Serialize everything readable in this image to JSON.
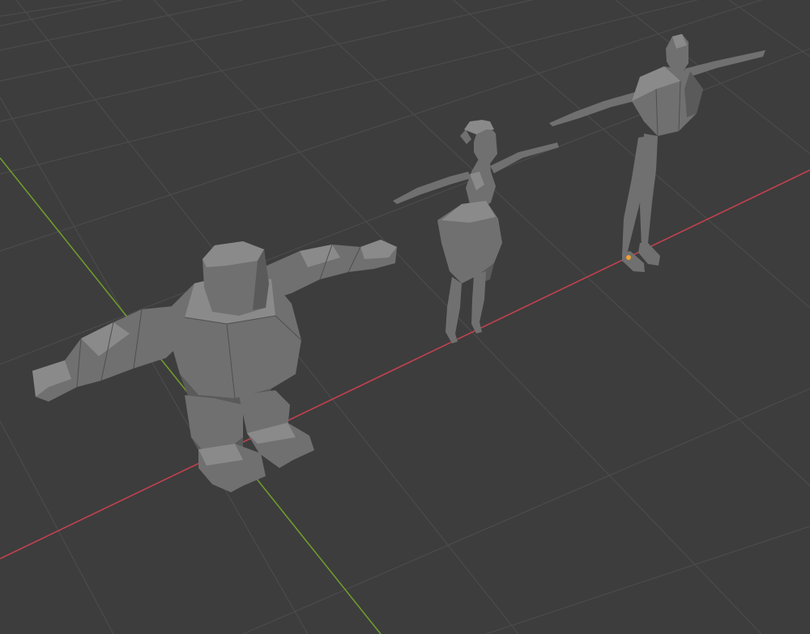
{
  "viewport": {
    "background_color": "#3d3d3d",
    "grid_color": "#4b4b4b",
    "x_axis_color": "#c2414f",
    "y_axis_color": "#6f9a2d",
    "origin_marker_color": "#f0a030"
  },
  "objects": [
    {
      "name": "chunky-character",
      "color": "#7a7a7a"
    },
    {
      "name": "slim-female-character",
      "color": "#7a7a7a"
    },
    {
      "name": "tall-thin-character",
      "color": "#7a7a7a"
    }
  ]
}
